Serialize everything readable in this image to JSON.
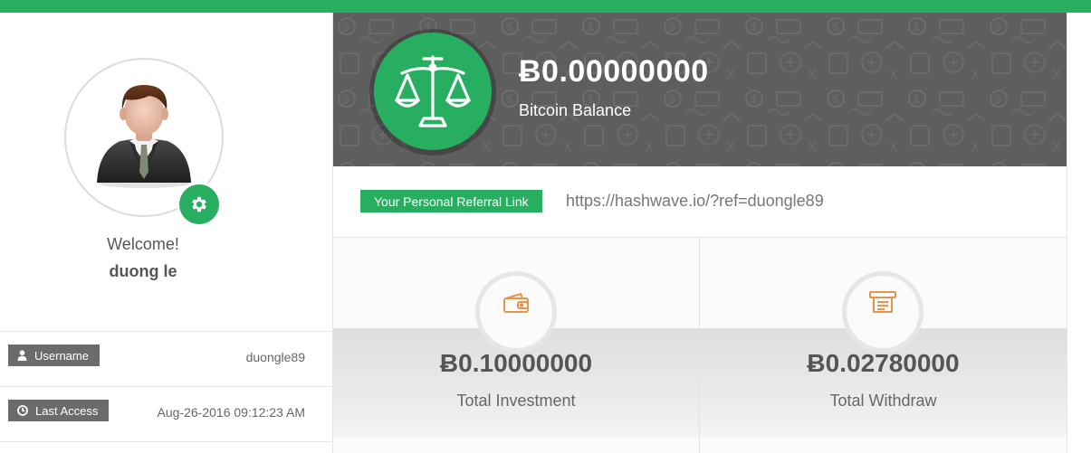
{
  "profile": {
    "welcome": "Welcome!",
    "name": "duong le",
    "rows": [
      {
        "label": "Username",
        "value": "duongle89",
        "icon": "user-icon"
      },
      {
        "label": "Last Access",
        "value": "Aug-26-2016 09:12:23 AM",
        "icon": "clock-icon"
      }
    ]
  },
  "hero": {
    "balance": "Ƀ0.00000000",
    "label": "Bitcoin Balance",
    "icon": "scales-icon"
  },
  "referral": {
    "label": "Your Personal Referral Link",
    "url": "https://hashwave.io/?ref=duongle89"
  },
  "stats": [
    {
      "value": "Ƀ0.10000000",
      "label": "Total Investment",
      "icon": "wallet-icon"
    },
    {
      "value": "Ƀ0.02780000",
      "label": "Total Withdraw",
      "icon": "atm-icon"
    }
  ],
  "colors": {
    "accent": "#27ae60",
    "hero_bg": "#5e5e5e",
    "tag_bg": "#6b6b6b",
    "stat_icon": "#e8944a"
  }
}
